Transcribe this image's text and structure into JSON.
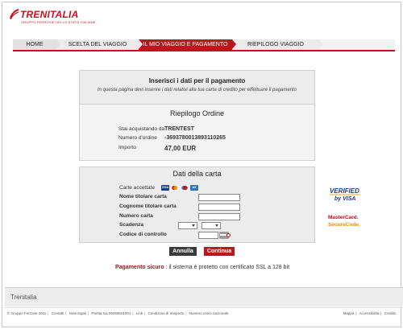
{
  "header": {
    "brand": "TRENITALIA",
    "tagline": "GRUPPO FERROVIE DELLO STATO ITALIANE",
    "brand_color": "#c0141d"
  },
  "tabs": [
    {
      "label": "HOME",
      "active": false
    },
    {
      "label": "SCELTA DEL VIAGGIO",
      "active": false
    },
    {
      "label": "IL MIO VIAGGIO E PAGAMENTO",
      "active": true
    },
    {
      "label": "RIEPILOGO VIAGGIO",
      "active": false
    }
  ],
  "intro": {
    "title": "Inserisci i dati per il pagamento",
    "subtitle": "In questa pagina devi inserire i dati relativi alla tua carta di credito per effettuare il pagamento"
  },
  "order": {
    "title": "Riepilogo Ordine",
    "rows": [
      {
        "label": "Stai acquistando da",
        "value": "TRENTEST"
      },
      {
        "label": "Numero d'ordine",
        "value": "-3693780013893110265"
      },
      {
        "label": "Importo",
        "value": "47,00 EUR"
      }
    ]
  },
  "card": {
    "title": "Dati della carta",
    "accepted_label": "Carte accettate",
    "accepted_cards": [
      "VISA",
      "MasterCard",
      "Maestro",
      "American Express"
    ],
    "fields": {
      "holder_name": {
        "label": "Nome titolare carta",
        "value": ""
      },
      "holder_surname": {
        "label": "Cognome titolare carta",
        "value": ""
      },
      "number": {
        "label": "Numero carta",
        "value": ""
      },
      "expiry": {
        "label": "Scadenza",
        "month": "",
        "year": ""
      },
      "cvv": {
        "label": "Codice di controllo",
        "value": ""
      }
    }
  },
  "buttons": {
    "cancel": "Annulla",
    "continue": "Continua"
  },
  "secure": {
    "strong": "Pagamento sicuro",
    "text": " : il sistema è protetto con certificato SSL a 128 bit"
  },
  "badges": {
    "visa_line1": "VERIFIED",
    "visa_line2": "by VISA",
    "mc_line1": "MasterCard.",
    "mc_line2": "SecureCode."
  },
  "footer": {
    "brand": "Trenitalia",
    "links": [
      "© Gruppo Ferrovie 2011",
      "Contatti",
      "Note legali",
      "Partita Iva 05058501001",
      "Link",
      "Condizioni di trasporto",
      "Numero unico nazionale"
    ],
    "right_links": [
      "Mappa",
      "Accessibilità",
      "Credits"
    ]
  }
}
